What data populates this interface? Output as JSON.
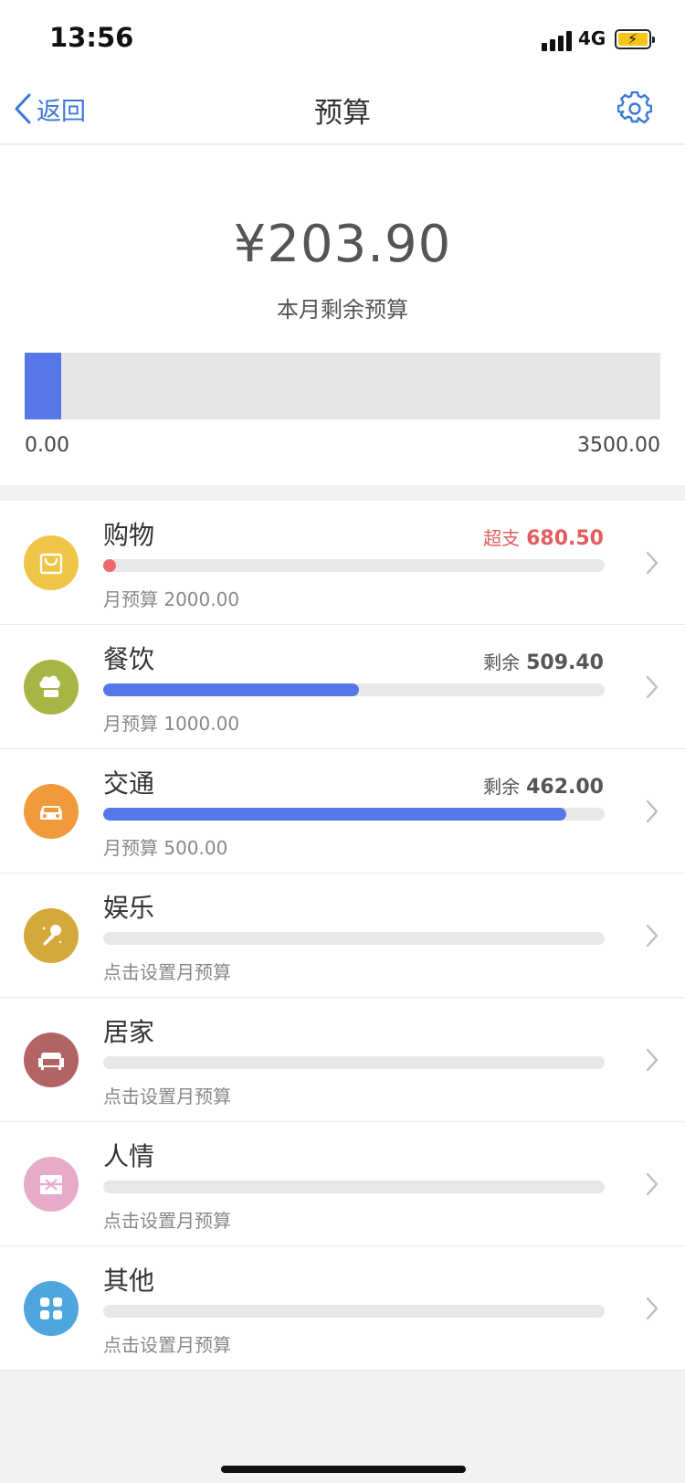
{
  "status_bar": {
    "time": "13:56",
    "network": "4G",
    "battery_color": "#f5c518"
  },
  "nav": {
    "back_label": "返回",
    "title": "预算",
    "accent": "#3b78d8"
  },
  "summary": {
    "remaining_amount": "¥203.90",
    "remaining_label": "本月剩余预算",
    "bar_min": "0.00",
    "bar_max": "3500.00",
    "bar_fraction": 0.058,
    "bar_color": "#5677e8"
  },
  "categories": [
    {
      "name": "购物",
      "status_label": "超支",
      "status_value": "680.50",
      "status_color": "#e45d5d",
      "progress": 0,
      "over": true,
      "subtitle": "月预算 2000.00",
      "icon": "shopping-bag-icon",
      "icon_color": "#eec546"
    },
    {
      "name": "餐饮",
      "status_label": "剩余",
      "status_value": "509.40",
      "status_color": "#555555",
      "progress": 0.51,
      "over": false,
      "subtitle": "月预算 1000.00",
      "icon": "chef-hat-icon",
      "icon_color": "#a6b544"
    },
    {
      "name": "交通",
      "status_label": "剩余",
      "status_value": "462.00",
      "status_color": "#555555",
      "progress": 0.924,
      "over": false,
      "subtitle": "月预算 500.00",
      "icon": "car-icon",
      "icon_color": "#f19a3b"
    },
    {
      "name": "娱乐",
      "status_label": "",
      "status_value": "",
      "status_color": "#555555",
      "progress": 0,
      "over": false,
      "subtitle": "点击设置月预算",
      "icon": "microphone-icon",
      "icon_color": "#d4a93c"
    },
    {
      "name": "居家",
      "status_label": "",
      "status_value": "",
      "status_color": "#555555",
      "progress": 0,
      "over": false,
      "subtitle": "点击设置月预算",
      "icon": "sofa-icon",
      "icon_color": "#b26464"
    },
    {
      "name": "人情",
      "status_label": "",
      "status_value": "",
      "status_color": "#555555",
      "progress": 0,
      "over": false,
      "subtitle": "点击设置月预算",
      "icon": "gift-icon",
      "icon_color": "#e6abc9"
    },
    {
      "name": "其他",
      "status_label": "",
      "status_value": "",
      "status_color": "#555555",
      "progress": 0,
      "over": false,
      "subtitle": "点击设置月预算",
      "icon": "grid-icon",
      "icon_color": "#4ea6dc"
    }
  ],
  "colors": {
    "progress_fill": "#5677e8",
    "over_dot": "#f06a6a"
  }
}
